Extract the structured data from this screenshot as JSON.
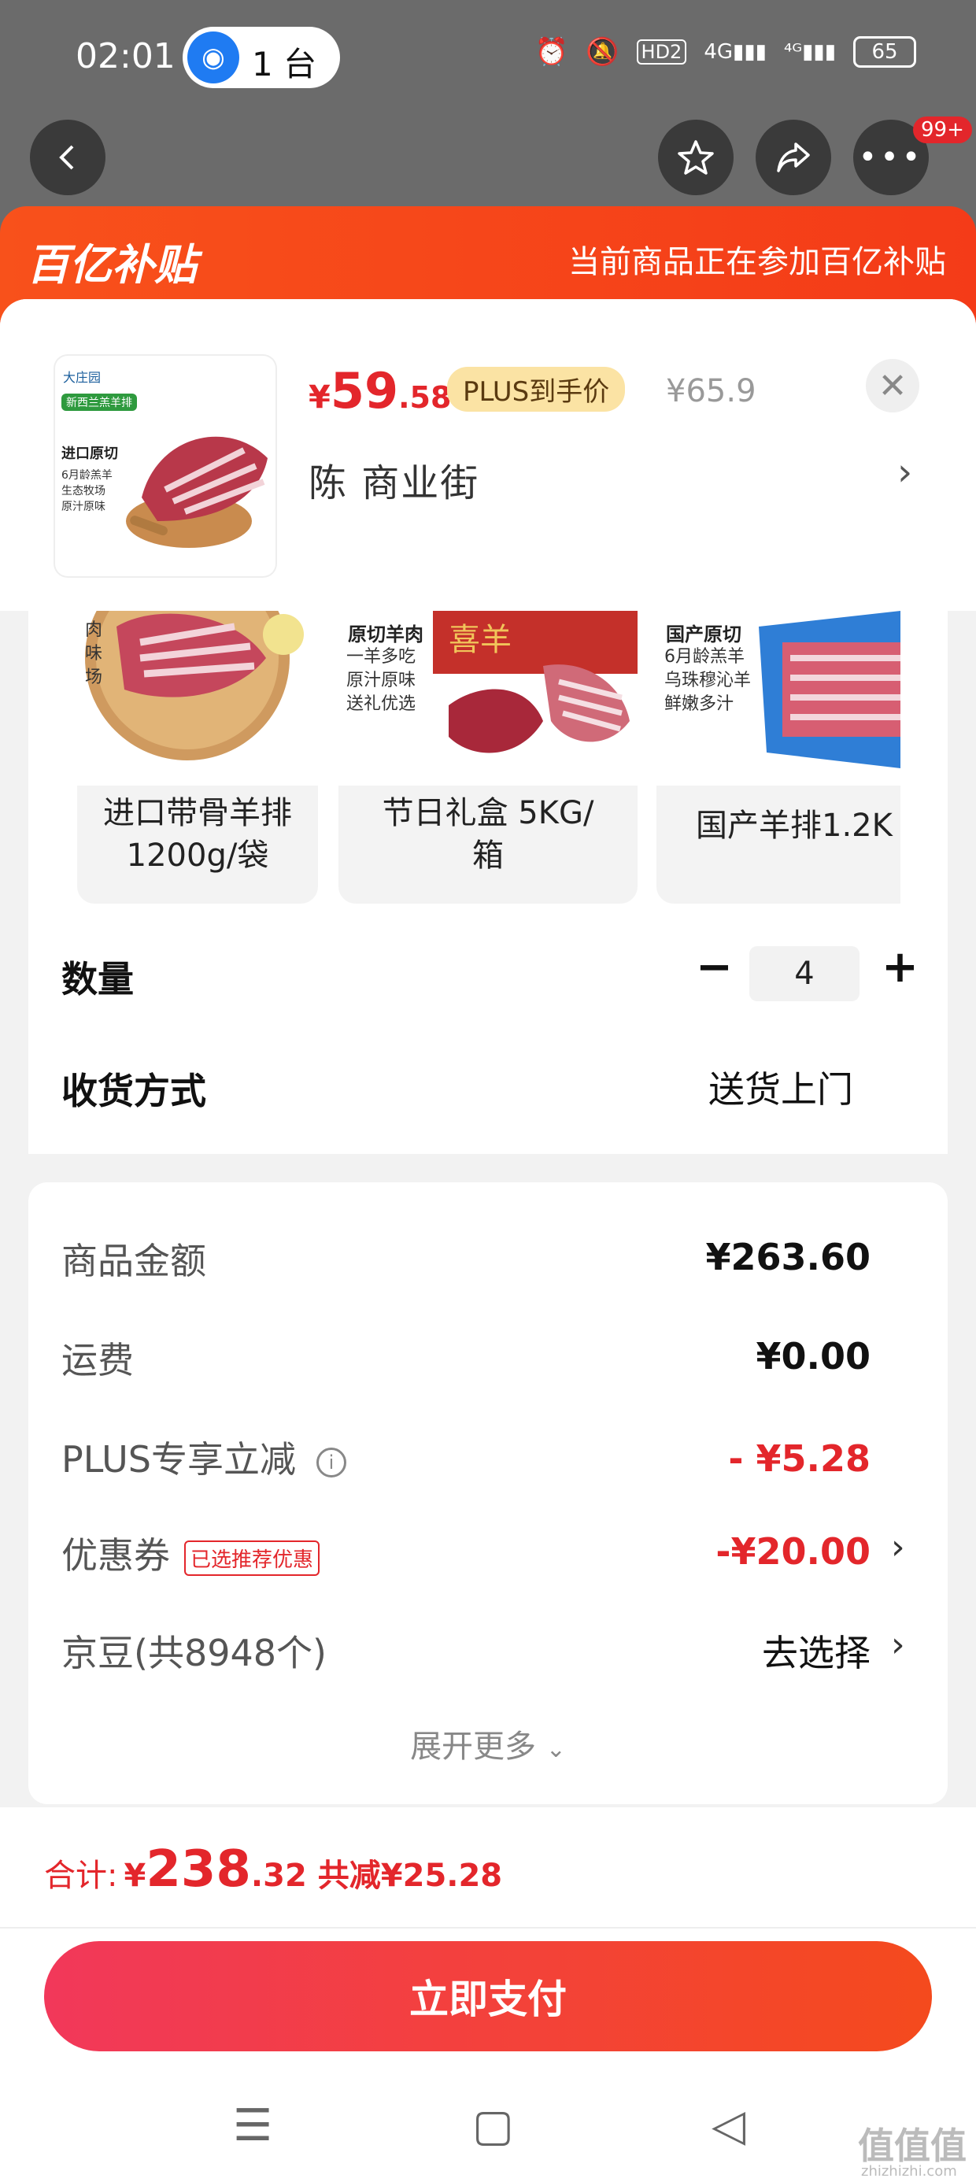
{
  "status": {
    "time": "02:01",
    "cast_label": "1 台",
    "network_label": "4G",
    "hd_label": "HD2",
    "battery": "65"
  },
  "nav": {
    "badge": "99+"
  },
  "banner": {
    "logo": "百亿补贴",
    "text": "当前商品正在参加百亿补贴"
  },
  "product": {
    "price_currency": "¥",
    "price_main": "59",
    "price_decimal": ".58",
    "plus_tag": "PLUS到手价",
    "original_price": "¥65.9",
    "address": "陈  商业街",
    "thumb_brand": "大庄园",
    "thumb_tag": "新西兰羔羊排",
    "thumb_title": "进口原切",
    "thumb_features": [
      "6月龄羔羊",
      "生态牧场",
      "原汁原味"
    ]
  },
  "variants": [
    {
      "label": "进口带骨羊排\n1200g/袋",
      "features": [
        "肉",
        "味",
        "场"
      ]
    },
    {
      "label": "节日礼盒 5KG/\n箱",
      "title": "原切羊肉",
      "features": [
        "一羊多吃",
        "原汁原味",
        "送礼优选"
      ]
    },
    {
      "label": "国产羊排1.2K",
      "title": "国产原切",
      "features": [
        "6月龄羔羊",
        "乌珠穆沁羊",
        "鲜嫩多汁"
      ]
    }
  ],
  "quantity": {
    "label": "数量",
    "value": "4",
    "minus": "−",
    "plus": "+"
  },
  "shipping": {
    "label": "收货方式",
    "value": "送货上门"
  },
  "summary": {
    "goods_label": "商品金额",
    "goods_value": "¥263.60",
    "freight_label": "运费",
    "freight_value": "¥0.00",
    "plus_label": "PLUS专享立减",
    "plus_value": "- ¥5.28",
    "coupon_label": "优惠券",
    "coupon_tag": "已选推荐优惠",
    "coupon_value": "-¥20.00",
    "jd_label": "京豆(共8948个)",
    "jd_value": "去选择",
    "expand": "展开更多"
  },
  "footer": {
    "total_label": "合计:",
    "total_currency": "¥",
    "total_main": "238",
    "total_decimal": ".32",
    "saved": "共减¥25.28",
    "pay_button": "立即支付"
  },
  "watermark": {
    "main": "值值值",
    "sub": "zhizhizhi.com"
  }
}
